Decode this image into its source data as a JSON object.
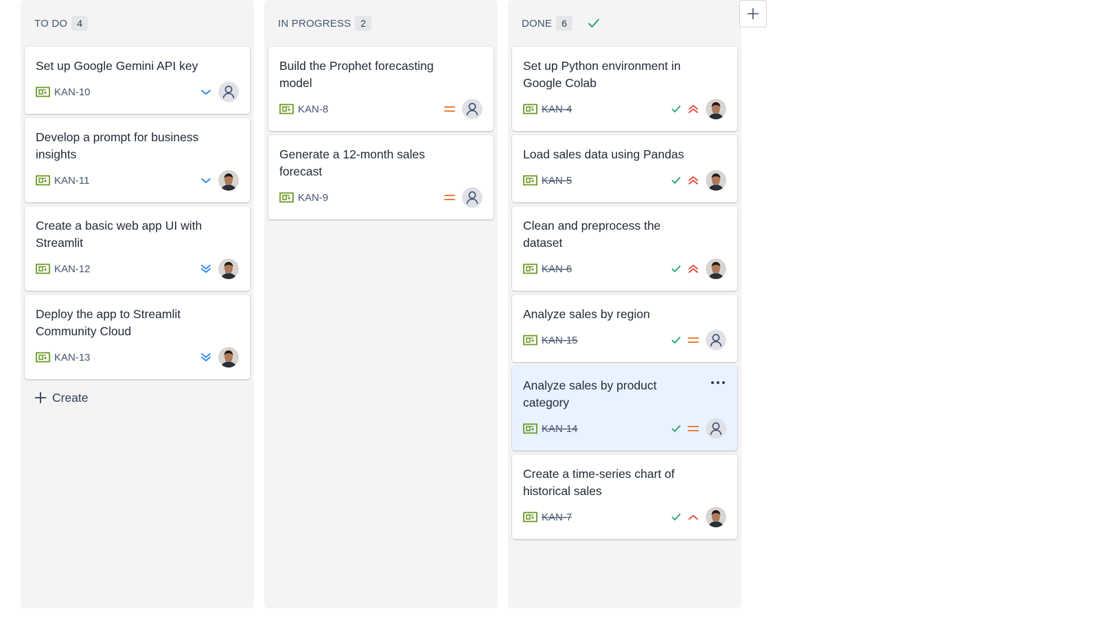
{
  "columns": [
    {
      "title": "TO DO",
      "count": "4",
      "cards": [
        {
          "title": "Set up Google Gemini API key",
          "key": "KAN-10",
          "priority": "low",
          "assignee": "unassigned"
        },
        {
          "title": "Develop a prompt for business insights",
          "key": "KAN-11",
          "priority": "low",
          "assignee": "user"
        },
        {
          "title": "Create a basic web app UI with Streamlit",
          "key": "KAN-12",
          "priority": "lowest",
          "assignee": "user"
        },
        {
          "title": "Deploy the app to Streamlit Community Cloud",
          "key": "KAN-13",
          "priority": "lowest",
          "assignee": "user"
        }
      ],
      "create_label": "Create"
    },
    {
      "title": "IN PROGRESS",
      "count": "2",
      "cards": [
        {
          "title": "Build the Prophet forecasting model",
          "key": "KAN-8",
          "priority": "medium",
          "assignee": "unassigned"
        },
        {
          "title": "Generate a 12-month sales forecast",
          "key": "KAN-9",
          "priority": "medium",
          "assignee": "unassigned"
        }
      ]
    },
    {
      "title": "DONE",
      "count": "6",
      "cards": [
        {
          "title": "Set up Python environment in Google Colab",
          "key": "KAN-4",
          "priority": "highest",
          "assignee": "user",
          "done": true
        },
        {
          "title": "Load sales data using Pandas",
          "key": "KAN-5",
          "priority": "highest",
          "assignee": "user",
          "done": true
        },
        {
          "title": "Clean and preprocess the dataset",
          "key": "KAN-6",
          "priority": "highest",
          "assignee": "user",
          "done": true
        },
        {
          "title": "Analyze sales by region",
          "key": "KAN-15",
          "priority": "medium",
          "assignee": "unassigned",
          "done": true
        },
        {
          "title": "Analyze sales by product category",
          "key": "KAN-14",
          "priority": "medium",
          "assignee": "unassigned",
          "done": true,
          "selected": true
        },
        {
          "title": "Create a time-series chart of historical sales",
          "key": "KAN-7",
          "priority": "high",
          "assignee": "user",
          "done": true
        }
      ]
    }
  ],
  "icons": {
    "story": "story-icon",
    "done_check": "check-icon",
    "add_column": "plus-icon",
    "more": "more-options-icon"
  },
  "colors": {
    "story_green": "#6a9a23",
    "priority_low": "#2684ff",
    "priority_medium": "#e97f33",
    "priority_high": "#e2483d",
    "done_check": "#22a06b",
    "selected_card": "#e9f2ff",
    "column_bg": "#f4f4f5"
  }
}
